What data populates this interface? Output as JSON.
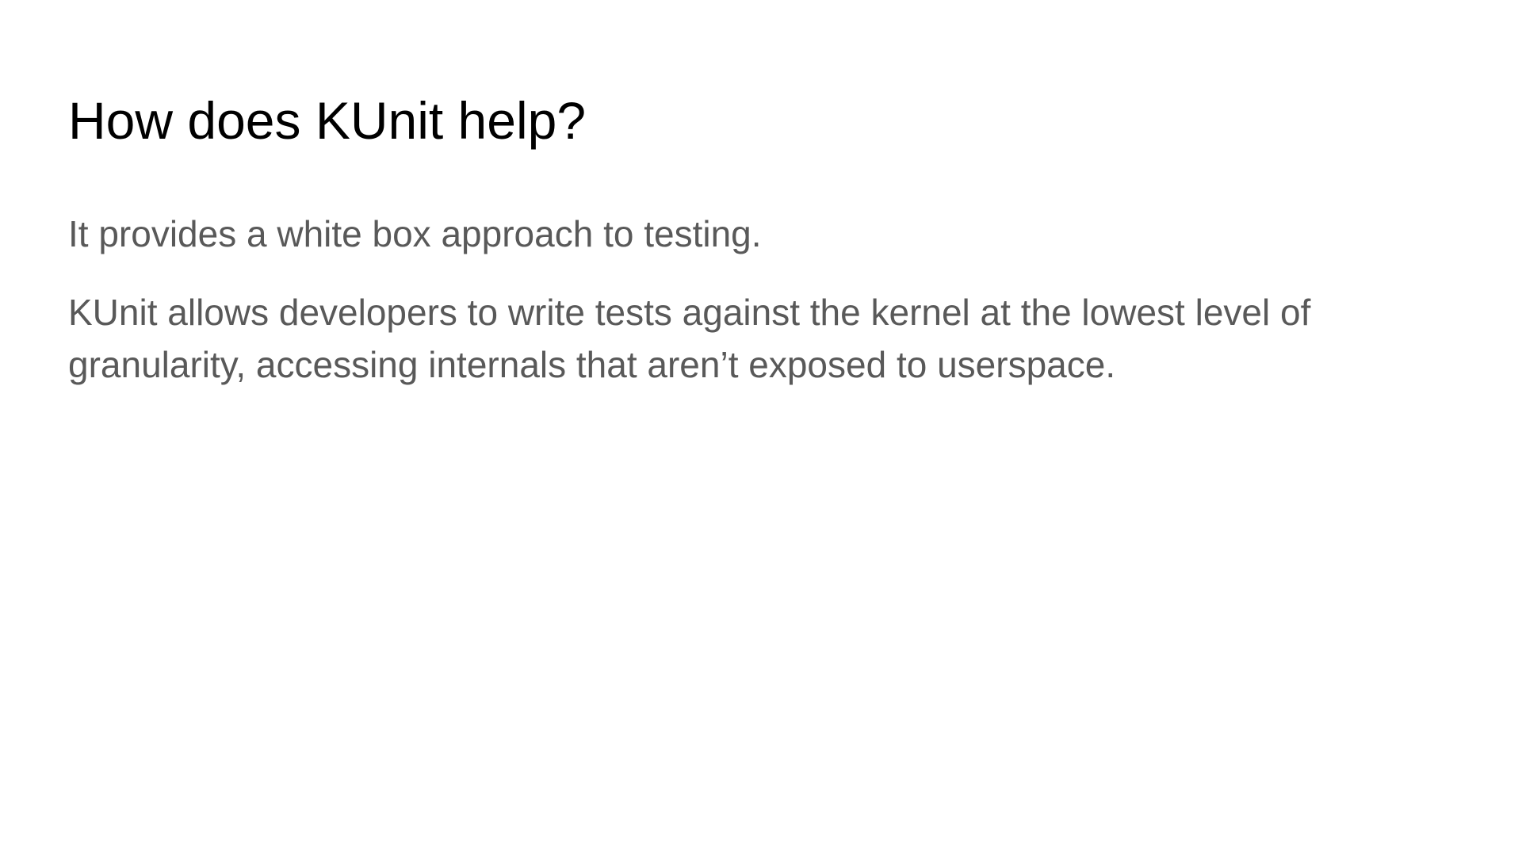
{
  "slide": {
    "title": "How does KUnit help?",
    "paragraphs": [
      "It provides a white box approach to testing.",
      "KUnit allows developers to write tests against the kernel at the lowest level of granularity, accessing internals that aren’t exposed to userspace."
    ]
  },
  "colors": {
    "background": "#ffffff",
    "title_text": "#000000",
    "body_text": "#595959"
  }
}
